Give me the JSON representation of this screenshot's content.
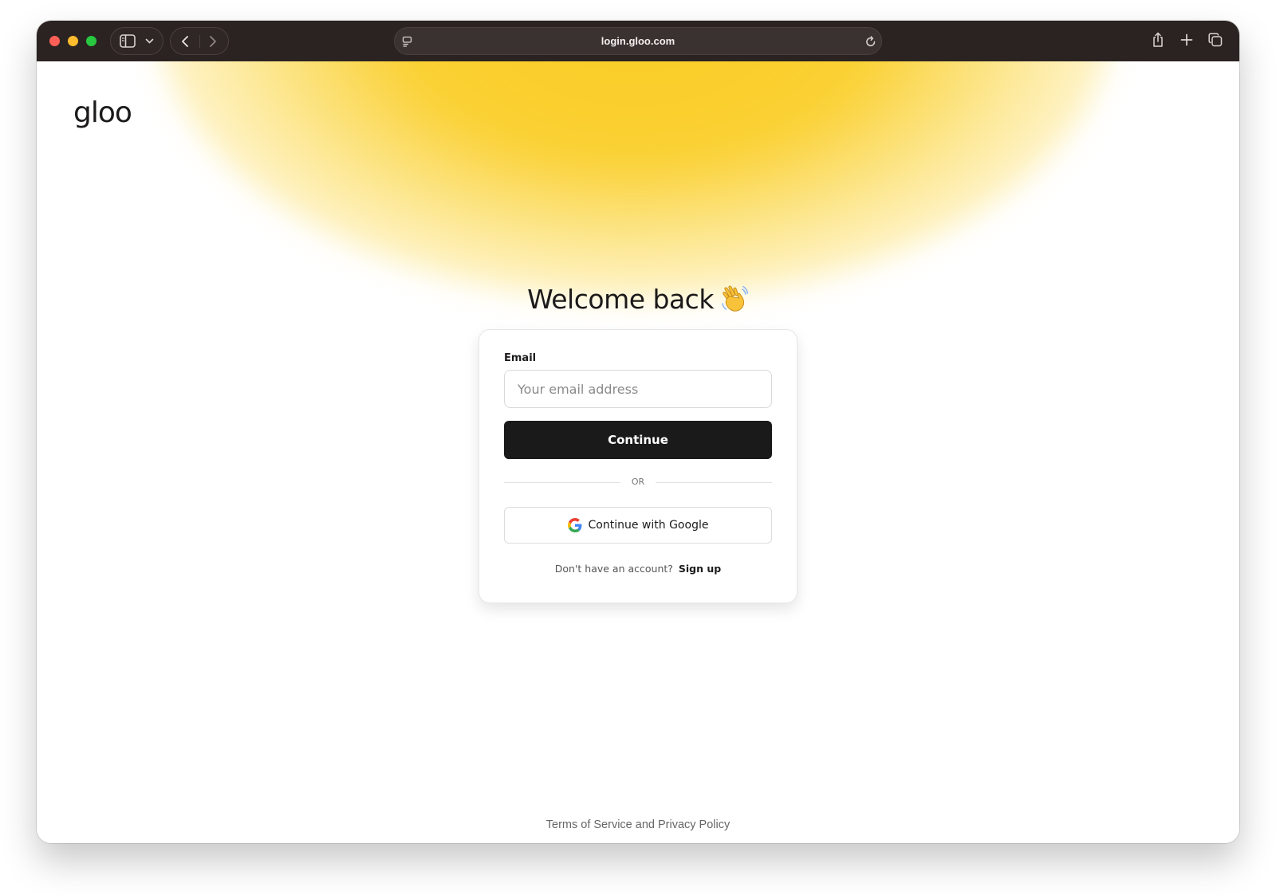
{
  "browser": {
    "url": "login.gloo.com",
    "icons": [
      "sidebar-icon",
      "chevron-down-icon",
      "back-arrow-icon",
      "forward-arrow-icon",
      "site-settings-icon",
      "reload-icon",
      "share-icon",
      "new-tab-icon",
      "tabs-overview-icon"
    ]
  },
  "page": {
    "logo": "gloo",
    "heading": "Welcome back",
    "heading_emoji": "waving-hand-icon",
    "email_label": "Email",
    "email_placeholder": "Your email address",
    "continue_label": "Continue",
    "or_label": "OR",
    "google_label": "Continue with Google",
    "signup_prompt": "Don't have an account?",
    "signup_link": "Sign up",
    "footer": "Terms of Service and Privacy Policy"
  },
  "colors": {
    "accent_glow": "#facc24",
    "primary_button": "#1a1a1a",
    "chrome_bg": "#2b2321"
  }
}
